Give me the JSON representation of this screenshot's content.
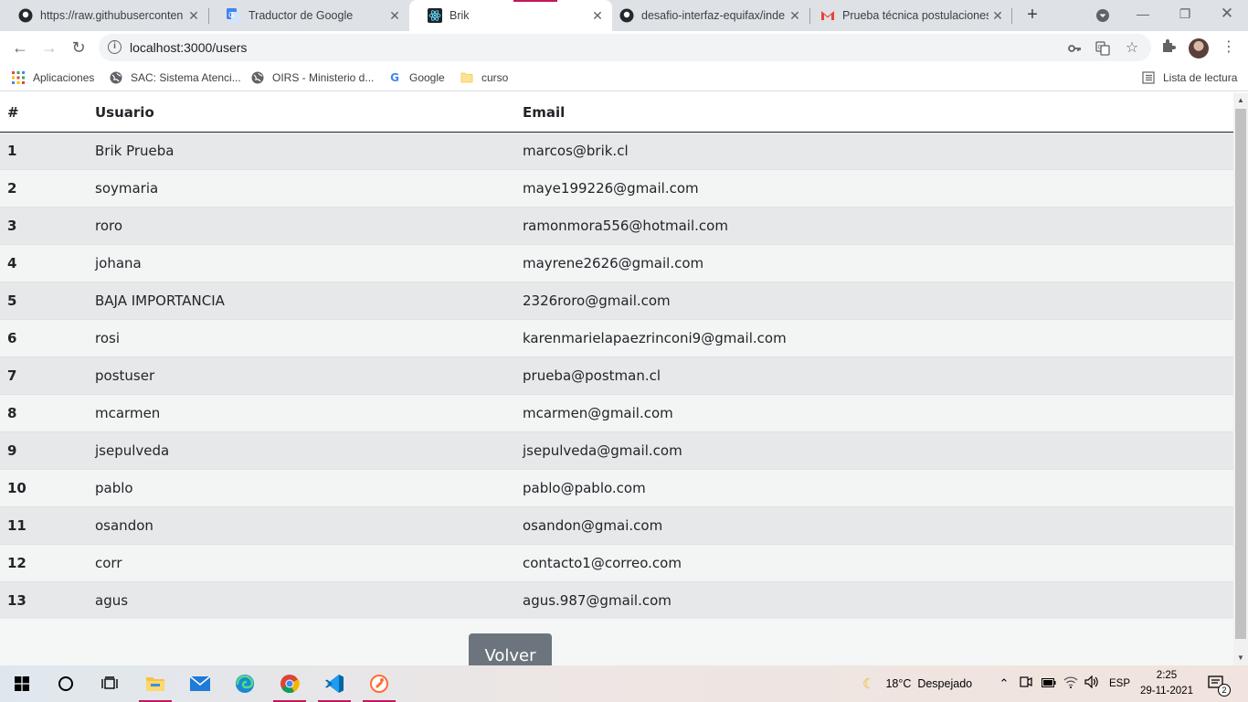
{
  "browser": {
    "tabs": [
      {
        "title": "https://raw.githubuserconten",
        "icon": "github-icon"
      },
      {
        "title": "Traductor de Google",
        "icon": "google-translate-icon"
      },
      {
        "title": "Brik",
        "icon": "react-icon"
      },
      {
        "title": "desafio-interfaz-equifax/inde",
        "icon": "github-icon"
      },
      {
        "title": "Prueba técnica postulaciones",
        "icon": "gmail-icon"
      }
    ],
    "url": "localhost:3000/users",
    "bookmarks": [
      {
        "label": "Aplicaciones",
        "icon": "apps-grid-icon"
      },
      {
        "label": "SAC: Sistema Atenci...",
        "icon": "globe-icon"
      },
      {
        "label": "OIRS - Ministerio d...",
        "icon": "globe-icon"
      },
      {
        "label": "Google",
        "icon": "google-icon"
      },
      {
        "label": "curso",
        "icon": "folder-icon"
      }
    ],
    "reading_list": "Lista de lectura"
  },
  "table": {
    "headers": [
      "#",
      "Usuario",
      "Email"
    ],
    "rows": [
      {
        "id": "1",
        "user": "Brik Prueba",
        "email": "marcos@brik.cl"
      },
      {
        "id": "2",
        "user": "soymaria",
        "email": "maye199226@gmail.com"
      },
      {
        "id": "3",
        "user": "roro",
        "email": "ramonmora556@hotmail.com"
      },
      {
        "id": "4",
        "user": "johana",
        "email": "mayrene2626@gmail.com"
      },
      {
        "id": "5",
        "user": "BAJA IMPORTANCIA",
        "email": "2326roro@gmail.com"
      },
      {
        "id": "6",
        "user": "rosi",
        "email": "karenmarielapaezrinconi9@gmail.com"
      },
      {
        "id": "7",
        "user": "postuser",
        "email": "prueba@postman.cl"
      },
      {
        "id": "8",
        "user": "mcarmen",
        "email": "mcarmen@gmail.com"
      },
      {
        "id": "9",
        "user": "jsepulveda",
        "email": "jsepulveda@gmail.com"
      },
      {
        "id": "10",
        "user": "pablo",
        "email": "pablo@pablo.com"
      },
      {
        "id": "11",
        "user": "osandon",
        "email": "osandon@gmai.com"
      },
      {
        "id": "12",
        "user": "corr",
        "email": "contacto1@correo.com"
      },
      {
        "id": "13",
        "user": "agus",
        "email": "agus.987@gmail.com"
      }
    ]
  },
  "volver_label": "Volver",
  "taskbar": {
    "weather": "18°C  Despejado",
    "lang": "ESP",
    "time": "2:25",
    "date": "29-11-2021",
    "notifications": "2"
  },
  "colors": {
    "button_secondary": "#6c757d",
    "row_odd": "#e7e8e9",
    "row_even": "#f3f4f4"
  }
}
